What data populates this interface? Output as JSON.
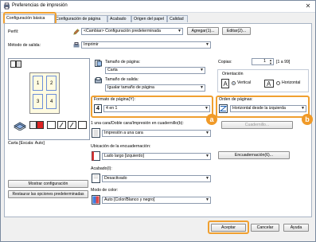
{
  "window": {
    "title": "Preferencias de impresión",
    "close_glyph": "✕"
  },
  "tabs": [
    {
      "label": "Configuración básica"
    },
    {
      "label": "Configuración de página"
    },
    {
      "label": "Acabado"
    },
    {
      "label": "Origen del papel"
    },
    {
      "label": "Calidad"
    }
  ],
  "profile": {
    "label": "Perfil:",
    "value": "<Cambiar> Configuración predeterminada",
    "add_button": "Agregar(1)...",
    "edit_button": "Editar(2)..."
  },
  "output_method": {
    "label": "Método de salida:",
    "value": "Imprimir"
  },
  "preview": {
    "caption": "Carta [Escala: Auto]",
    "pages": [
      "1",
      "2",
      "3",
      "4"
    ]
  },
  "page_size": {
    "label": "Tamaño de página:",
    "value": "Carta"
  },
  "output_size": {
    "label": "Tamaño de salida:",
    "value": "Igualar tamaño de página"
  },
  "copies": {
    "label": "Copias:",
    "value": "1",
    "range": "[1 a 99]"
  },
  "orientation": {
    "label": "Orientación",
    "vertical": "Vertical",
    "horizontal": "Horizontal",
    "selected": "vertical"
  },
  "page_layout": {
    "label": "Formato de página(Y):",
    "value": "4 en 1",
    "icon_text": "4"
  },
  "page_order": {
    "label": "Orden de páginas:",
    "value": "Horizontal desde la izquierda"
  },
  "duplex": {
    "label": "1 una cara/Doble cara/Impresión en cuadernillo(b):",
    "value": "Impresión a una cara",
    "booklet_button": "Cuadernillo..."
  },
  "binding": {
    "label": "Ubicación de la encuadernación:",
    "value": "Lado largo [izquierdo]",
    "binding_button": "Encuadernación(6)..."
  },
  "finishing": {
    "label": "Acabado(I):",
    "value": "Desactivado"
  },
  "color_mode": {
    "label": "Modo de color:",
    "value": "Auto [Color/Blanco y negro]"
  },
  "left_buttons": {
    "show_settings": "Mostrar configuración",
    "restore_defaults": "Restaurar las opciones predeterminadas"
  },
  "footer": {
    "accept": "Aceptar",
    "cancel": "Cancelar",
    "help": "Ayuda"
  },
  "badges": {
    "a": "a",
    "b": "b"
  },
  "colors": {
    "highlight": "#f0a030",
    "badge": "#f09a28"
  }
}
